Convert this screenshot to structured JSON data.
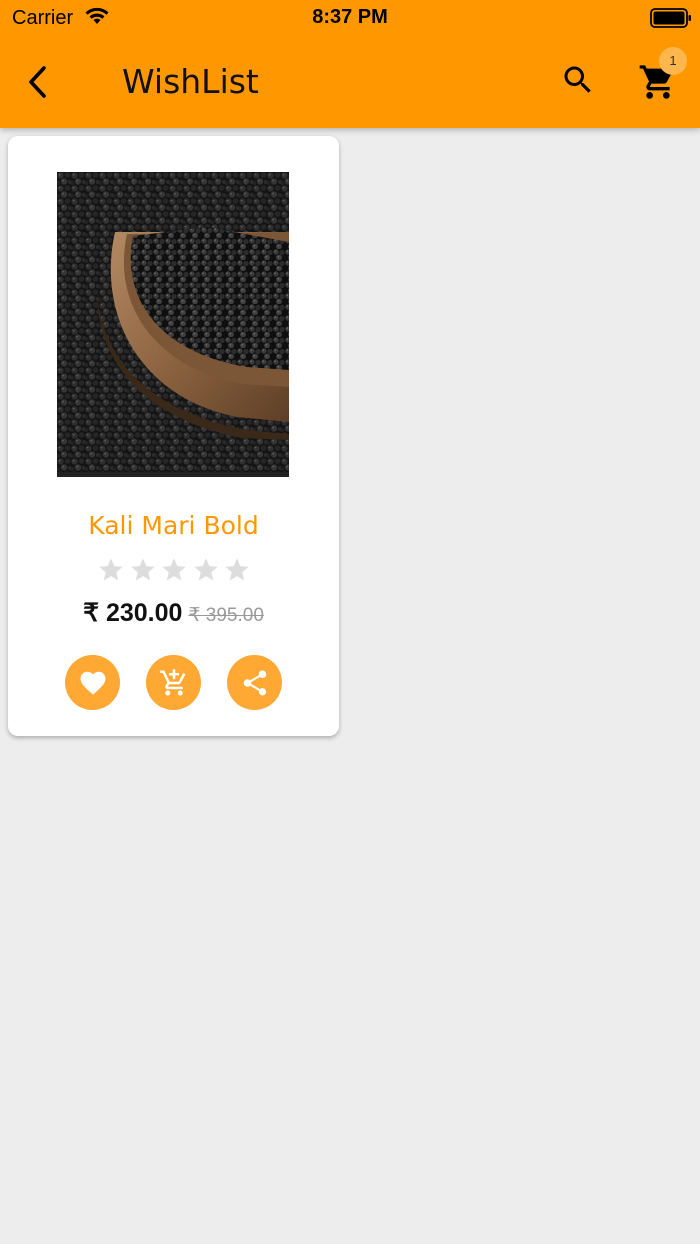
{
  "status_bar": {
    "carrier": "Carrier",
    "time": "8:37 PM"
  },
  "header": {
    "title": "WishList",
    "cart_count": "1",
    "back_icon": "chevron-left-icon",
    "search_icon": "search-icon",
    "cart_icon": "cart-icon"
  },
  "products": [
    {
      "name": "Kali Mari Bold",
      "rating": 0,
      "rating_max": 5,
      "price": "₹ 230.00",
      "old_price": "₹ 395.00",
      "actions": [
        "heart-icon",
        "add-to-cart-icon",
        "share-icon"
      ]
    }
  ],
  "colors": {
    "accent": "#ff9800",
    "action_button": "#ffa834",
    "star_empty": "#dddddd",
    "background": "#ededee"
  }
}
